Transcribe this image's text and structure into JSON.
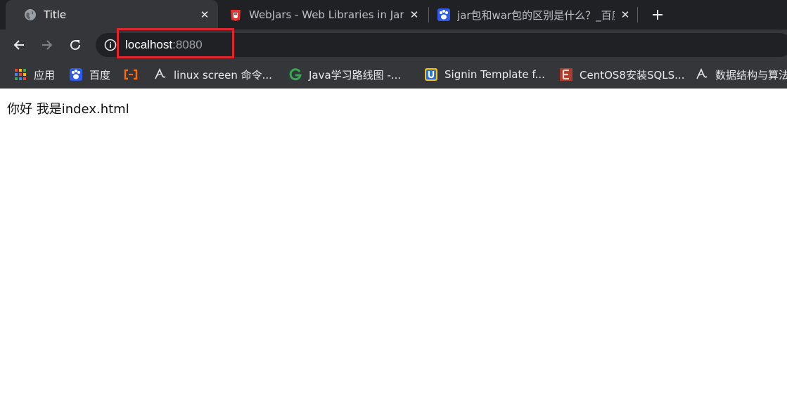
{
  "tabs": [
    {
      "title": "Title",
      "icon": "globe-icon",
      "active": true
    },
    {
      "title": "WebJars - Web Libraries in Jars",
      "icon": "webjars-icon",
      "active": false
    },
    {
      "title": "jar包和war包的区别是什么？_百度知道",
      "icon": "baidu-paw-icon",
      "active": false
    }
  ],
  "toolbar": {
    "url_host": "localhost",
    "url_port": ":8080"
  },
  "bookmarks": [
    {
      "label": "应用",
      "icon": "apps-grid-icon"
    },
    {
      "label": "百度",
      "icon": "baidu-paw-icon"
    },
    {
      "label": "",
      "icon": "aliyun-icon"
    },
    {
      "label": "linux screen 命令...",
      "icon": "gitbook-icon"
    },
    {
      "label": "Java学习路线图 -...",
      "icon": "g-icon"
    },
    {
      "label": "Signin Template f...",
      "icon": "u-badge-icon"
    },
    {
      "label": "CentOS8安装SQLS...",
      "icon": "centos-e-icon"
    },
    {
      "label": "数据结构与算法",
      "icon": "gitbook-icon"
    }
  ],
  "page": {
    "body_text": "你好 我是index.html"
  },
  "colors": {
    "tabstrip_bg": "#202124",
    "toolbar_bg": "#35363a",
    "highlight": "#e0252d"
  }
}
